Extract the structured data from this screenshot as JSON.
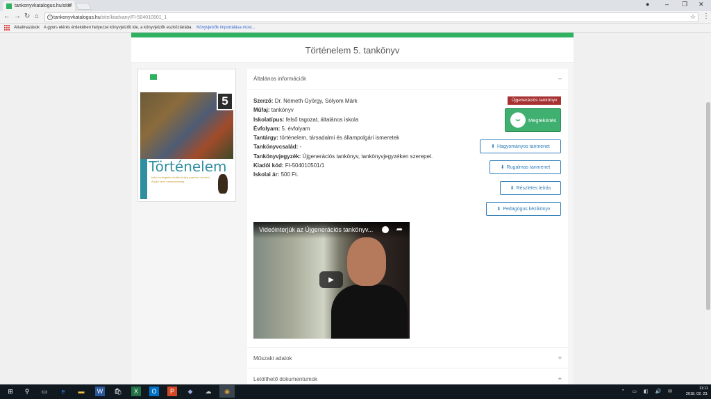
{
  "browser": {
    "tab_title": "tankonyvkatalogus.hu/site/",
    "url_host": "tankonyvkatalogus.hu",
    "url_path": "/site/kiadvany/FI-504010501_1",
    "bookmarks": {
      "apps_label": "Alkalmazások",
      "hint_text": "A gyors elérés érdekében helyezze könyvjelzőit ide, a könyvjelzők eszköztárába.",
      "import_link": "Könyvjelzők importálása most..."
    }
  },
  "page": {
    "title": "Történelem 5. tankönyv",
    "cover": {
      "number": "5",
      "title": "Történelem",
      "words": "tafta  honfoglalás  kelták  térkép  papirusz  szobrát  Árpád  vezír  kereszténység"
    },
    "general_info": {
      "header": "Általános információk",
      "toggle": "–",
      "fields": [
        {
          "label": "Szerző:",
          "value": "Dr. Németh György, Sólyom Márk"
        },
        {
          "label": "Műfaj:",
          "value": "tankönyv"
        },
        {
          "label": "Iskolatípus:",
          "value": "felső tagozat, általános iskola"
        },
        {
          "label": "Évfolyam:",
          "value": "5. évfolyam"
        },
        {
          "label": "Tantárgy:",
          "value": "történelem, társadalmi és állampolgári ismeretek"
        },
        {
          "label": "Tankönyvcsalád:",
          "value": "-"
        },
        {
          "label": "Tankönyvjegyzék:",
          "value": "Újgenerációs tankönyv, tankönyvjegyzéken szerepel."
        },
        {
          "label": "Kiadói kód:",
          "value": "FI-504010501/1"
        },
        {
          "label": "Iskolai ár:",
          "value": "500 Ft."
        }
      ],
      "badge": "Újgenerációs tankönyv",
      "view_button": "Megtekintés",
      "downloads": [
        "Hagyományos tanmenet",
        "Rugalmas tanmenet",
        "Részletes leírás",
        "Pedagógus kézikönyv"
      ]
    },
    "video": {
      "title": "Videóinterjúk az Újgenerációs tankönyv..."
    },
    "accordions": [
      {
        "label": "Műszaki adatok",
        "toggle": "+"
      },
      {
        "label": "Letölthető dokumentumok",
        "toggle": "+"
      }
    ]
  },
  "taskbar": {
    "time": "11:11",
    "date": "2018. 02. 23."
  }
}
